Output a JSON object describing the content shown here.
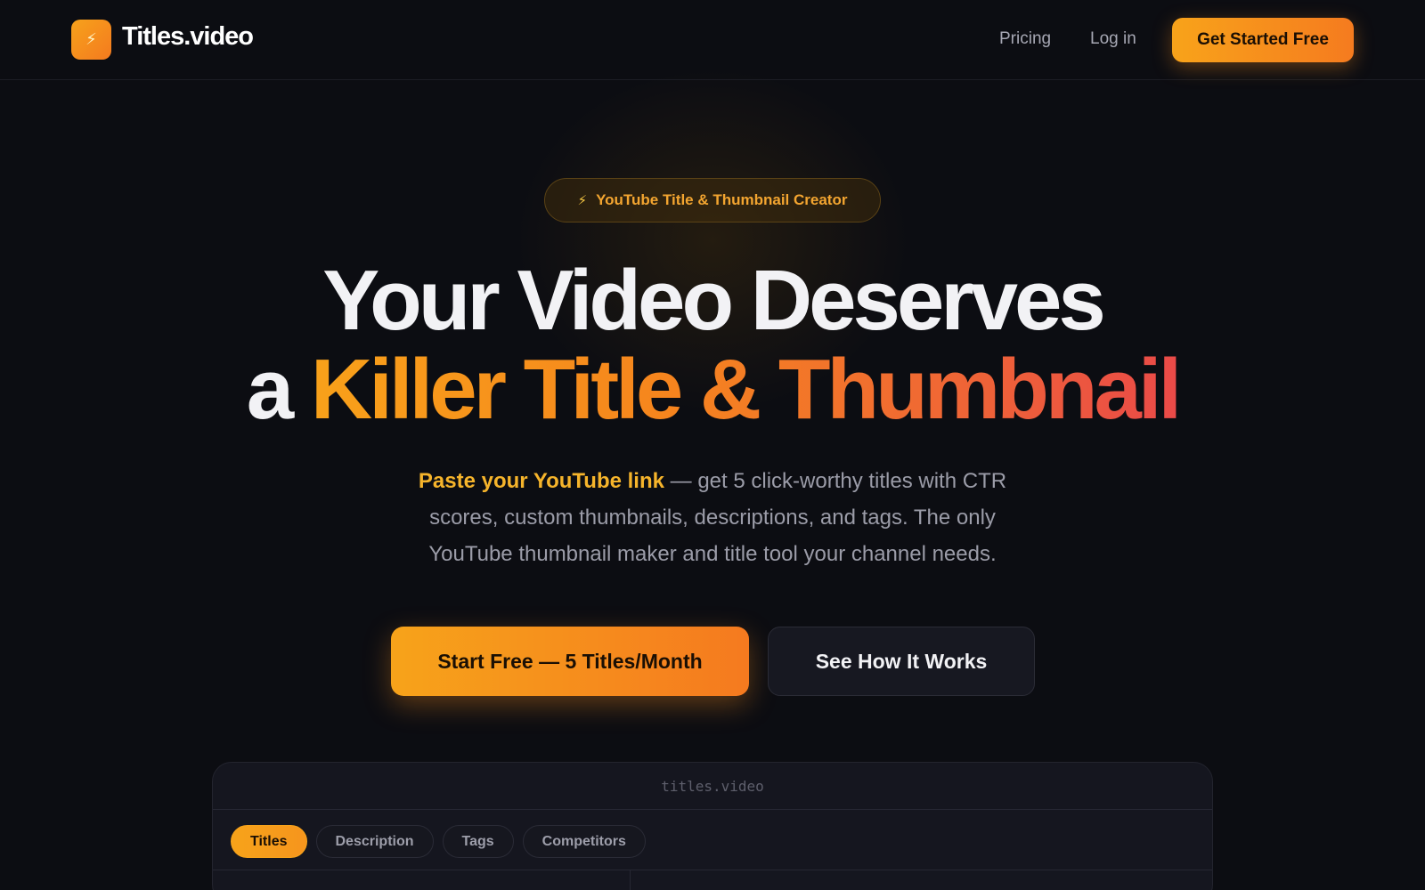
{
  "nav": {
    "logo_icon": "lightning-bolt-icon",
    "logo_glyph": "⚡",
    "brand": "Titles.video",
    "links": [
      "Pricing",
      "Log in"
    ],
    "cta": "Get Started Free"
  },
  "hero": {
    "badge_glyph": "⚡",
    "badge": "YouTube Title & Thumbnail Creator",
    "headline_line1": "Your Video Deserves",
    "headline_line2_prefix": "a ",
    "headline_line2_highlight": "Killer Title & Thumbnail",
    "subtitle_highlight": "Paste your YouTube link",
    "subtitle_rest": " — get 5 click-worthy titles with CTR scores, custom thumbnails, descriptions, and tags. The only YouTube thumbnail maker and title tool your channel needs.",
    "primary_cta": "Start Free — 5 Titles/Month",
    "secondary_cta": "See How It Works"
  },
  "preview": {
    "url": "titles.video",
    "tabs": [
      "Titles",
      "Description",
      "Tags",
      "Competitors"
    ],
    "active_tab": "Titles"
  },
  "colors": {
    "background": "#0c0d12",
    "accent_start": "#f8a11a",
    "accent_end": "#ea4a48",
    "highlight_text": "#f6b42b"
  }
}
